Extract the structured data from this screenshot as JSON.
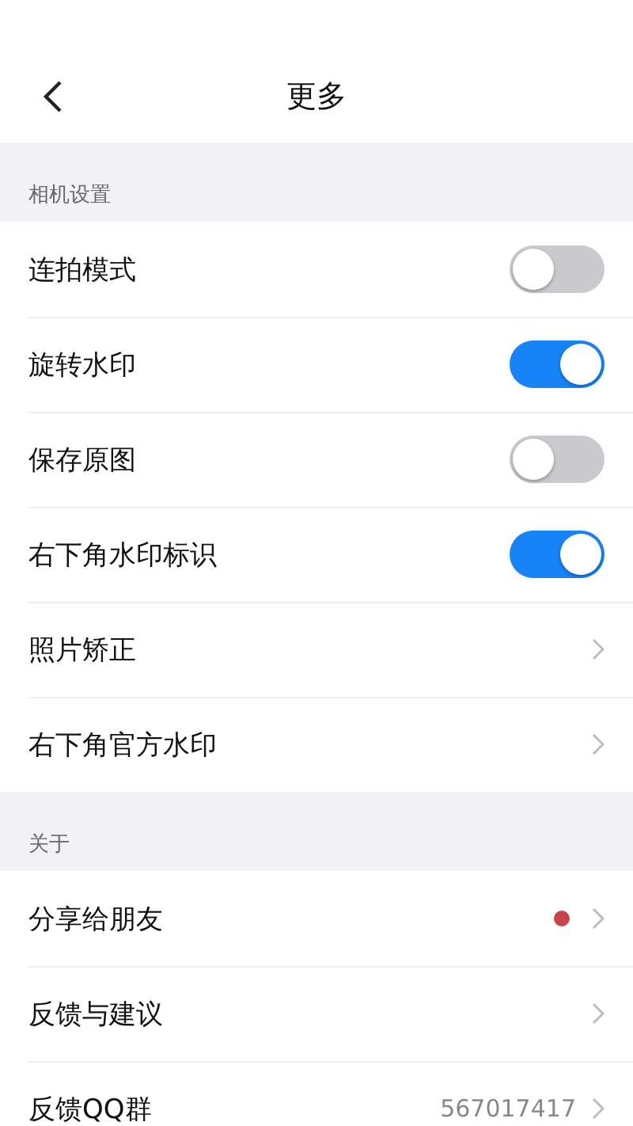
{
  "header": {
    "title": "更多"
  },
  "sections": [
    {
      "title": "相机设置",
      "items": [
        {
          "kind": "toggle",
          "label": "连拍模式",
          "on": false
        },
        {
          "kind": "toggle",
          "label": "旋转水印",
          "on": true
        },
        {
          "kind": "toggle",
          "label": "保存原图",
          "on": false
        },
        {
          "kind": "toggle",
          "label": "右下角水印标识",
          "on": true
        },
        {
          "kind": "link",
          "label": "照片矫正"
        },
        {
          "kind": "link",
          "label": "右下角官方水印"
        }
      ]
    },
    {
      "title": "关于",
      "items": [
        {
          "kind": "link",
          "label": "分享给朋友",
          "badge": true,
          "color": "#c9444a"
        },
        {
          "kind": "link",
          "label": "反馈与建议"
        },
        {
          "kind": "link",
          "label": "反馈QQ群",
          "value": "567017417"
        }
      ]
    }
  ]
}
